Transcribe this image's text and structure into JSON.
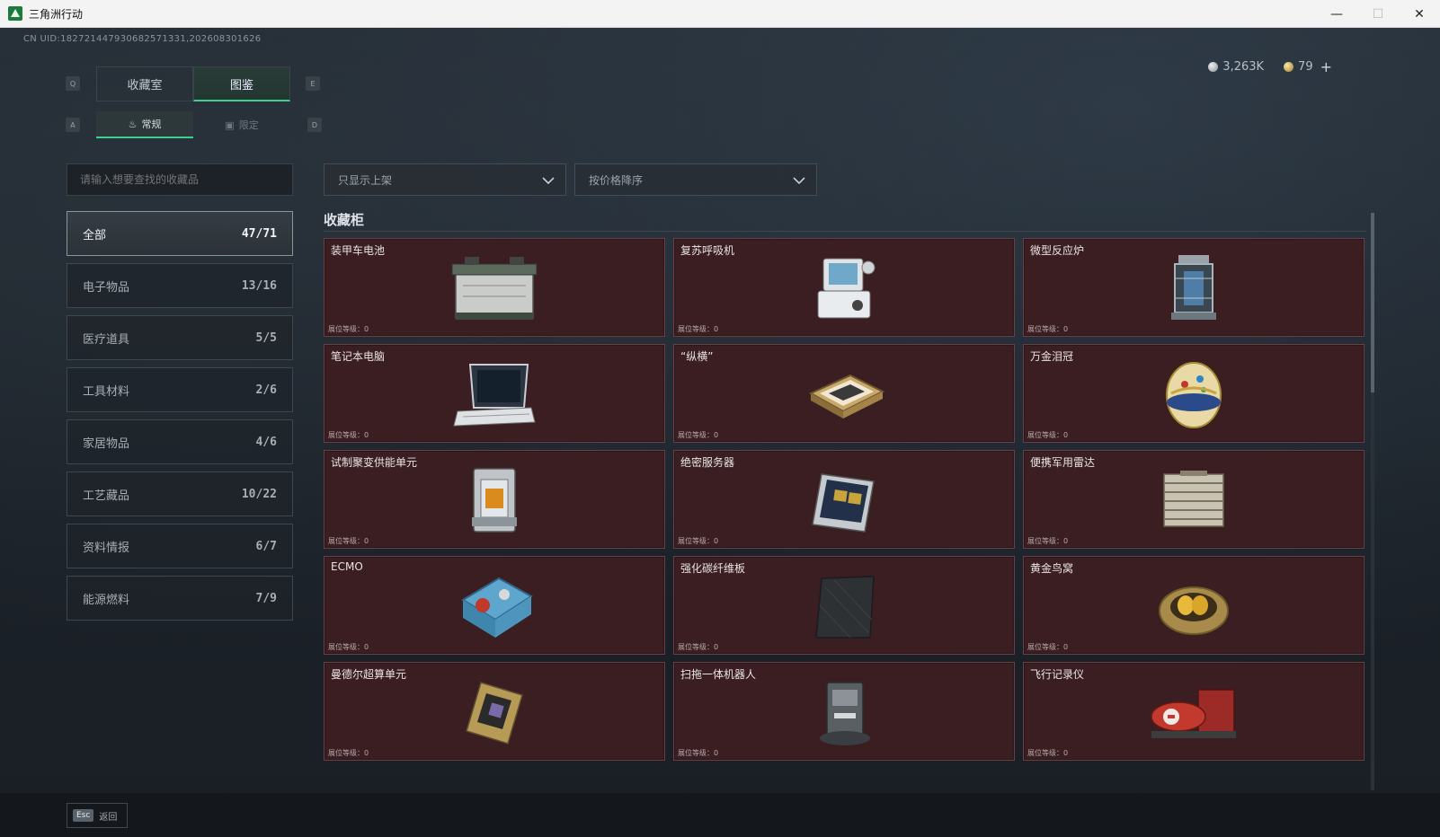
{
  "window": {
    "title": "三角洲行动",
    "minimize": "—",
    "maximize": "☐",
    "close": "✕"
  },
  "uid": "CN UID:1827214479306825713​31,202608301626",
  "currency": {
    "silver": "3,263K",
    "gold": "79",
    "add": "+"
  },
  "keys": {
    "q": "Q",
    "e": "E",
    "a": "A",
    "d": "D"
  },
  "tabs": {
    "collection_room": "收藏室",
    "catalog": "图鉴"
  },
  "subtabs": {
    "regular": "常规",
    "limited": "限定"
  },
  "search": {
    "placeholder": "请输入想要查找的收藏品"
  },
  "filters": {
    "shelf": "只显示上架",
    "sort": "按价格降序"
  },
  "categories": [
    {
      "label": "全部",
      "count": "47/71"
    },
    {
      "label": "电子物品",
      "count": "13/16"
    },
    {
      "label": "医疗道具",
      "count": "5/5"
    },
    {
      "label": "工具材料",
      "count": "2/6"
    },
    {
      "label": "家居物品",
      "count": "4/6"
    },
    {
      "label": "工艺藏品",
      "count": "10/22"
    },
    {
      "label": "资料情报",
      "count": "6/7"
    },
    {
      "label": "能源燃料",
      "count": "7/9"
    }
  ],
  "section_title": "收藏柜",
  "level_label": "展位等级：0",
  "items": [
    {
      "name": "装甲车电池",
      "icon": "battery-icon"
    },
    {
      "name": "复苏呼吸机",
      "icon": "ventilator-icon"
    },
    {
      "name": "微型反应炉",
      "icon": "reactor-icon"
    },
    {
      "name": "笔记本电脑",
      "icon": "laptop-icon"
    },
    {
      "name": "“纵横”",
      "icon": "chessboard-icon"
    },
    {
      "name": "万金泪冠",
      "icon": "jeweled-egg-icon"
    },
    {
      "name": "试制聚变供能单元",
      "icon": "fusion-unit-icon"
    },
    {
      "name": "绝密服务器",
      "icon": "server-icon"
    },
    {
      "name": "便携军用雷达",
      "icon": "radar-icon"
    },
    {
      "name": "ECMO",
      "icon": "ecmo-icon"
    },
    {
      "name": "强化碳纤维板",
      "icon": "carbon-plate-icon"
    },
    {
      "name": "黄金鸟窝",
      "icon": "golden-nest-icon"
    },
    {
      "name": "曼德尔超算单元",
      "icon": "supercomputer-chip-icon"
    },
    {
      "name": "扫拖一体机器人",
      "icon": "robot-vacuum-icon"
    },
    {
      "name": "飞行记录仪",
      "icon": "flight-recorder-icon"
    }
  ],
  "footer": {
    "esc_key": "Esc",
    "back": "返回"
  },
  "colors": {
    "accent": "#3fcf8e",
    "card_bg": "#3a1e22",
    "card_border": "#6a4046"
  }
}
